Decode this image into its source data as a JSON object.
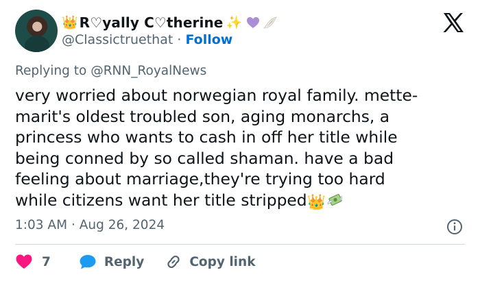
{
  "user": {
    "display_name_parts": [
      "R",
      "yally C",
      "therine"
    ],
    "heart_glyph": "♡",
    "handle": "@Classictruethat",
    "separator": "·",
    "follow_label": "Follow",
    "avatar_icon": "profile-photo"
  },
  "reply_context": {
    "prefix": "Replying to",
    "mention": "@RNN_RoyalNews"
  },
  "tweet": {
    "text": "very worried about norwegian royal family. mette-\nmarit's oldest troubled son, aging monarchs, a\nprincess who wants to cash in off her title while\nbeing conned by so called shaman. have a bad\nfeeling about marriage,they're trying too hard\nwhile citizens want her title stripped",
    "emojis": [
      "crown-icon",
      "money-with-wings-icon"
    ]
  },
  "meta": {
    "time": "1:03 AM",
    "separator": "·",
    "date": "Aug 26, 2024"
  },
  "actions": {
    "like_count": "7",
    "reply_label": "Reply",
    "copy_label": "Copy link"
  },
  "colors": {
    "link_blue": "#006fd6",
    "like_pink": "#f91880",
    "reply_blue": "#1d9bf0",
    "muted_gray": "#536471",
    "text": "#0f1419",
    "divider": "#cfd9de"
  }
}
